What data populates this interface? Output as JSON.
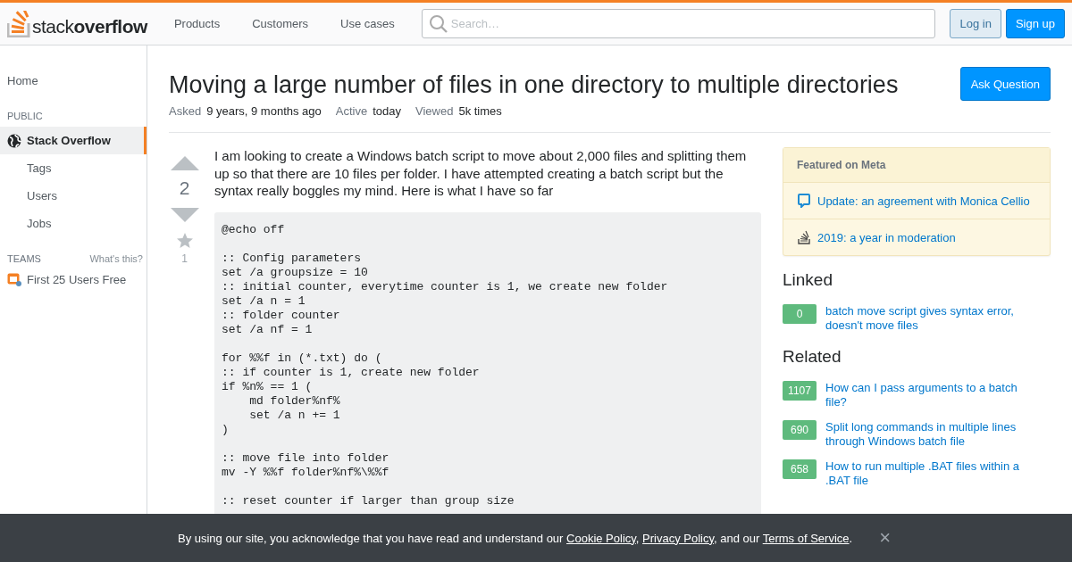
{
  "header": {
    "logo": {
      "light": "stack",
      "bold": "overflow"
    },
    "nav": [
      "Products",
      "Customers",
      "Use cases"
    ],
    "search": {
      "placeholder": "Search…"
    },
    "buttons": [
      {
        "label": "Log in",
        "kind": "secondary"
      },
      {
        "label": "Sign up",
        "kind": "primary"
      }
    ]
  },
  "sidebar": {
    "items": [
      {
        "kind": "link",
        "label": "Home",
        "selected": false
      },
      {
        "kind": "heading",
        "label": "PUBLIC"
      },
      {
        "kind": "site",
        "label": "Stack Overflow",
        "selected": true,
        "children": [
          {
            "label": "Tags",
            "selected": false
          },
          {
            "label": "Users",
            "selected": false
          },
          {
            "label": "Jobs",
            "selected": false
          }
        ]
      },
      {
        "kind": "heading",
        "label": "TEAMS",
        "aside": "What's this?"
      },
      {
        "kind": "team",
        "label": "First 25 Users Free",
        "selected": false
      }
    ]
  },
  "question": {
    "title": "Moving a large number of files in one directory to multiple directories",
    "ask_button": "Ask Question",
    "meta": [
      {
        "label": "Asked",
        "value": "9 years, 9 months ago"
      },
      {
        "label": "Active",
        "value": "today"
      },
      {
        "label": "Viewed",
        "value": "5k times"
      }
    ],
    "votes": "2",
    "bookmarks": "1",
    "body": "I am looking to create a Windows batch script to move about 2,000 files and splitting them up so that there are 10 files per folder. I have attempted creating a batch script but the syntax really boggles my mind. Here is what I have so far",
    "code": "@echo off\n\n:: Config parameters\nset /a groupsize = 10\n:: initial counter, everytime counter is 1, we create new folder\nset /a n = 1\n:: folder counter\nset /a nf = 1\n\nfor %%f in (*.txt) do (\n:: if counter is 1, create new folder\nif %n% == 1 (\n    md folder%nf%\n    set /a n += 1\n)\n\n:: move file into folder\nmv -Y %%f folder%nf%\\%%f\n\n:: reset counter if larger than group size"
  },
  "aside": {
    "featured": {
      "title": "Featured on Meta",
      "items": [
        {
          "kind": "comment",
          "text": "Update: an agreement with Monica Cellio"
        },
        {
          "kind": "stack",
          "text": "2019: a year in moderation"
        }
      ]
    },
    "linked": {
      "title": "Linked",
      "items": [
        {
          "score": "0",
          "text": "batch move script gives syntax error, doesn't move files"
        }
      ]
    },
    "related": {
      "title": "Related",
      "items": [
        {
          "score": "1107",
          "text": "How can I pass arguments to a batch file?"
        },
        {
          "score": "690",
          "text": "Split long commands in multiple lines through Windows batch file"
        },
        {
          "score": "658",
          "text": "How to run multiple .BAT files within a .BAT file"
        }
      ]
    }
  },
  "cookie_banner": {
    "parts": [
      {
        "kind": "text",
        "text": "By using our site, you acknowledge that you have read and understand our "
      },
      {
        "kind": "link",
        "text": "Cookie Policy"
      },
      {
        "kind": "text",
        "text": ", "
      },
      {
        "kind": "link",
        "text": "Privacy Policy"
      },
      {
        "kind": "text",
        "text": ", and our "
      },
      {
        "kind": "link",
        "text": "Terms of Service"
      },
      {
        "kind": "text",
        "text": "."
      }
    ],
    "close": "×"
  }
}
